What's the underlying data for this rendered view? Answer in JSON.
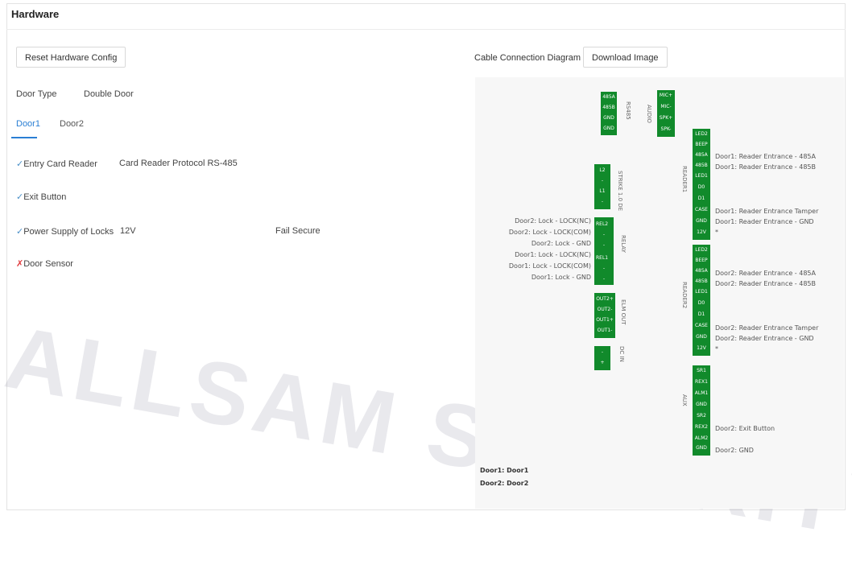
{
  "header": {
    "title": "Hardware"
  },
  "toolbar": {
    "reset_label": "Reset Hardware Config",
    "cable_label": "Cable Connection Diagram",
    "download_label": "Download Image"
  },
  "door_type": {
    "label": "Door Type",
    "value": "Double Door"
  },
  "tabs": [
    {
      "label": "Door1",
      "active": true
    },
    {
      "label": "Door2",
      "active": false
    }
  ],
  "features": [
    {
      "mark": "✓",
      "label": "Entry Card Reader",
      "extra": "Card Reader Protocol RS-485"
    },
    {
      "mark": "✓",
      "label": "Exit Button"
    },
    {
      "mark": "✓",
      "label": "Power Supply of Locks",
      "extra": "12V",
      "extra2": "Fail Secure"
    },
    {
      "mark": "✗",
      "label": "Door Sensor"
    }
  ],
  "diagram": {
    "rs485": {
      "pins": [
        "485A",
        "485B",
        "GND",
        "GND"
      ],
      "label": "RS485"
    },
    "audio": {
      "pins": [
        "MIC+",
        "MIC-",
        "SPK+",
        "SPK-"
      ],
      "label": "AUDIO"
    },
    "strike": {
      "pins": [
        "L2",
        "-",
        "L1",
        "-"
      ],
      "label": "STRIKE 1.0 DE"
    },
    "relay": {
      "pins": [
        "REL2",
        "-",
        "-",
        "REL1",
        "-",
        "-"
      ],
      "label": "RELAY"
    },
    "elm_out": {
      "pins": [
        "OUT2+",
        "OUT2-",
        "OUT1+",
        "OUT1-"
      ],
      "label": "ELM OUT"
    },
    "dc_in": {
      "pins": [
        "-",
        "+"
      ],
      "label": "DC IN"
    },
    "reader1": {
      "pins": [
        "LED2",
        "BEEP",
        "485A",
        "485B",
        "LED1",
        "D0",
        "D1",
        "CASE",
        "GND",
        "12V"
      ],
      "label": "READER1"
    },
    "reader2": {
      "pins": [
        "LED2",
        "BEEP",
        "485A",
        "485B",
        "LED1",
        "D0",
        "D1",
        "CASE",
        "GND",
        "12V"
      ],
      "label": "READER2"
    },
    "aux": {
      "pins": [
        "SR1",
        "REX1",
        "ALM1",
        "GND",
        "SR2",
        "REX2",
        "ALM2",
        "GND"
      ],
      "label": "AUX"
    },
    "relay_wires": [
      "Door2: Lock - LOCK(NC)",
      "Door2: Lock - LOCK(COM)",
      "Door2: Lock - GND",
      "Door1: Lock - LOCK(NC)",
      "Door1: Lock - LOCK(COM)",
      "Door1: Lock - GND"
    ],
    "reader1_wires": {
      "a": "Door1: Reader Entrance - 485A",
      "b": "Door1: Reader Entrance - 485B",
      "tamper": "Door1: Reader Entrance Tamper",
      "gnd": "Door1: Reader Entrance - GND",
      "star": "*"
    },
    "reader2_wires": {
      "a": "Door2: Reader Entrance - 485A",
      "b": "Door2: Reader Entrance - 485B",
      "tamper": "Door2: Reader Entrance Tamper",
      "gnd": "Door2: Reader Entrance - GND",
      "star": "*"
    },
    "aux_wires": {
      "exit": "Door2: Exit Button",
      "gnd": "Door2: GND"
    },
    "legend": [
      "Door1: Door1",
      "Door2: Door2"
    ]
  },
  "watermark": "ALLSAM SECURITY",
  "colors": {
    "accent": "#2a7fd4",
    "terminal": "#118a2b",
    "error": "#e0393c"
  }
}
